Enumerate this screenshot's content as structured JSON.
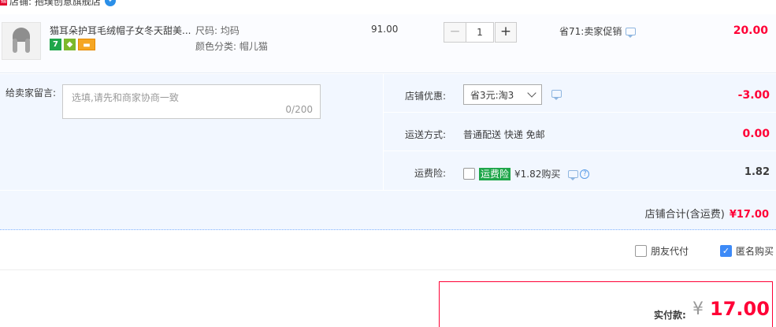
{
  "shop": {
    "label": "店铺: 抱璞创意旗舰店",
    "badge_text": "猫",
    "chat_icon": "chat-bubble-icon"
  },
  "item": {
    "title": "猫耳朵护耳毛绒帽子女冬天甜美...",
    "sku_size": "尺码: 均码",
    "sku_color": "颜色分类:  帽儿猫",
    "service_icons": [
      "seven-day-return-icon",
      "guarantee-icon",
      "credit-card-icon"
    ],
    "seven_label": "7",
    "unit_price": "91.00",
    "quantity": "1",
    "minus": "−",
    "plus": "+",
    "discount": "省71:卖家促销",
    "subtotal": "20.00"
  },
  "memo": {
    "label": "给卖家留言:",
    "placeholder": "选填,请先和商家协商一致",
    "count": "0/200"
  },
  "shop_discount": {
    "label": "店铺优惠:",
    "selected": "省3元:淘3",
    "amount": "-3.00"
  },
  "shipping": {
    "label": "运送方式:",
    "value": "普通配送 快递 免邮",
    "amount": "0.00"
  },
  "insurance": {
    "label": "运费险:",
    "tag": "运费险",
    "price": "¥1.82购买",
    "amount": "1.82",
    "help": "?"
  },
  "shop_total": {
    "label": "店铺合计(含运费)",
    "amount": "¥17.00"
  },
  "options": {
    "friend_pay": "朋友代付",
    "anonymous": "匿名购买",
    "check_mark": "✓"
  },
  "payment": {
    "label": "实付款:",
    "currency": "¥",
    "amount": "17.00"
  },
  "colors": {
    "accent_red": "#ff0036",
    "panel_blue": "#f2f7ff",
    "check_blue": "#3d8af7",
    "insurance_green": "#1fa64a"
  }
}
